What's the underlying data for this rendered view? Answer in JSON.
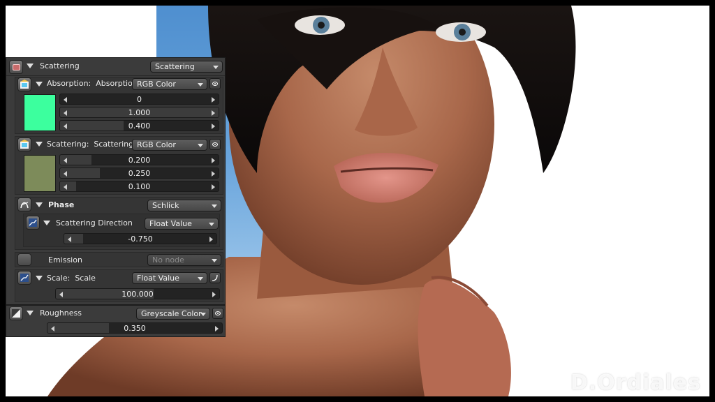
{
  "panel": {
    "header": {
      "label": "Scattering",
      "dropdown": "Scattering"
    },
    "absorption": {
      "label": "Absorption:",
      "sub": "Absorption",
      "dropdown": "RGB Color",
      "values": [
        {
          "text": "0",
          "fraction": 0.0
        },
        {
          "text": "1.000",
          "fraction": 1.0
        },
        {
          "text": "0.400",
          "fraction": 0.4
        }
      ],
      "swatch_color": "#3cff9e"
    },
    "scattering": {
      "label": "Scattering:",
      "sub": "Scattering",
      "dropdown": "RGB Color",
      "values": [
        {
          "text": "0.200",
          "fraction": 0.2
        },
        {
          "text": "0.250",
          "fraction": 0.25
        },
        {
          "text": "0.100",
          "fraction": 0.1
        }
      ],
      "swatch_color": "#7d8b5a"
    },
    "phase": {
      "label": "Phase",
      "dropdown": "Schlick"
    },
    "scattering_direction": {
      "label": "Scattering Direction",
      "dropdown": "Float Value",
      "value": {
        "text": "-0.750",
        "fraction": 0.125
      }
    },
    "emission": {
      "label": "Emission",
      "dropdown": "No node"
    },
    "scale": {
      "label": "Scale:",
      "sub": "Scale",
      "dropdown": "Float Value",
      "value": {
        "text": "100.000",
        "fraction": 0.6
      }
    },
    "roughness": {
      "label": "Roughness",
      "dropdown": "Greyscale Color",
      "value": {
        "text": "0.350",
        "fraction": 0.35
      }
    }
  },
  "watermark": "D.Ordiales"
}
